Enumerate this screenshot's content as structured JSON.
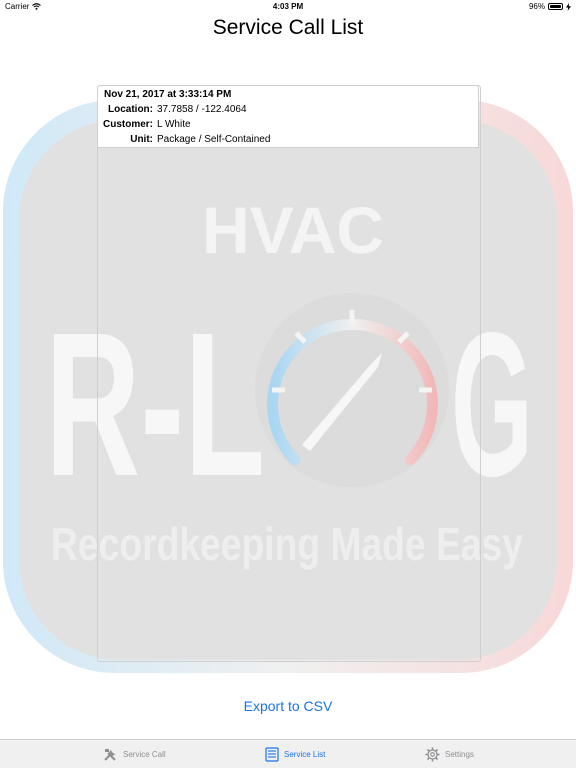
{
  "status_bar": {
    "carrier": "Carrier",
    "time": "4:03 PM",
    "battery": "96%",
    "battery_level": 0.96
  },
  "page": {
    "title": "Service Call List"
  },
  "background": {
    "heading": "HVAC",
    "logo_left": "R-L",
    "logo_right": "G",
    "tagline": "Recordkeeping Made Easy"
  },
  "service_calls": [
    {
      "date": "Nov 21, 2017 at 3:33:14 PM",
      "location_label": "Location:",
      "location": "37.7858 / -122.4064",
      "customer_label": "Customer:",
      "customer": "L White",
      "unit_label": "Unit:",
      "unit": "Package / Self-Contained"
    }
  ],
  "actions": {
    "export": "Export to CSV"
  },
  "tabs": [
    {
      "label": "Service Call",
      "icon": "tools-icon",
      "active": false
    },
    {
      "label": "Service List",
      "icon": "list-icon",
      "active": true
    },
    {
      "label": "Settings",
      "icon": "gear-icon",
      "active": false
    }
  ],
  "colors": {
    "accent": "#1a73e8",
    "cold": "#a9d6f2",
    "hot": "#f2b8b8"
  }
}
